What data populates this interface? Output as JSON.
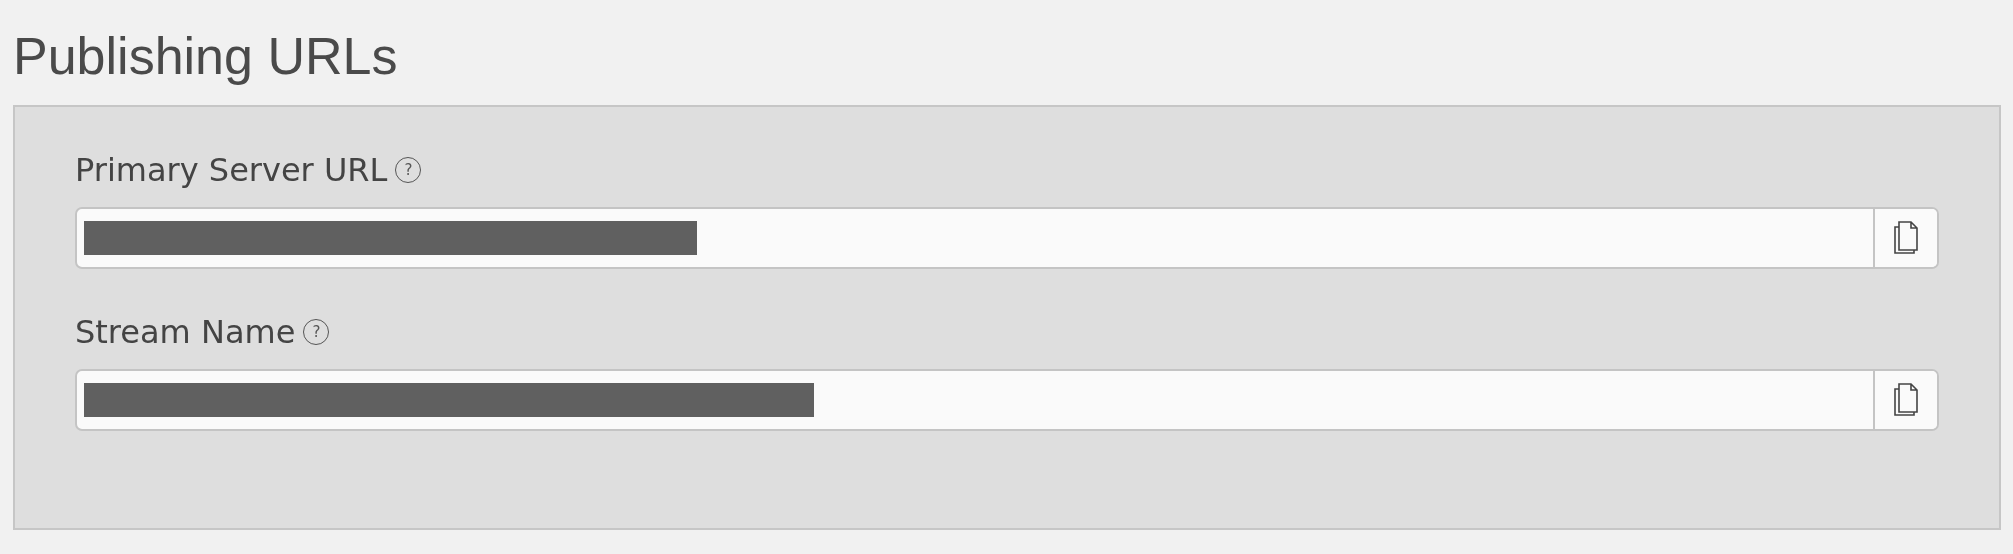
{
  "title": "Publishing URLs",
  "fields": [
    {
      "label": "Primary Server URL",
      "help": "?",
      "value_redacted": true
    },
    {
      "label": "Stream Name",
      "help": "?",
      "value_redacted": true
    }
  ]
}
